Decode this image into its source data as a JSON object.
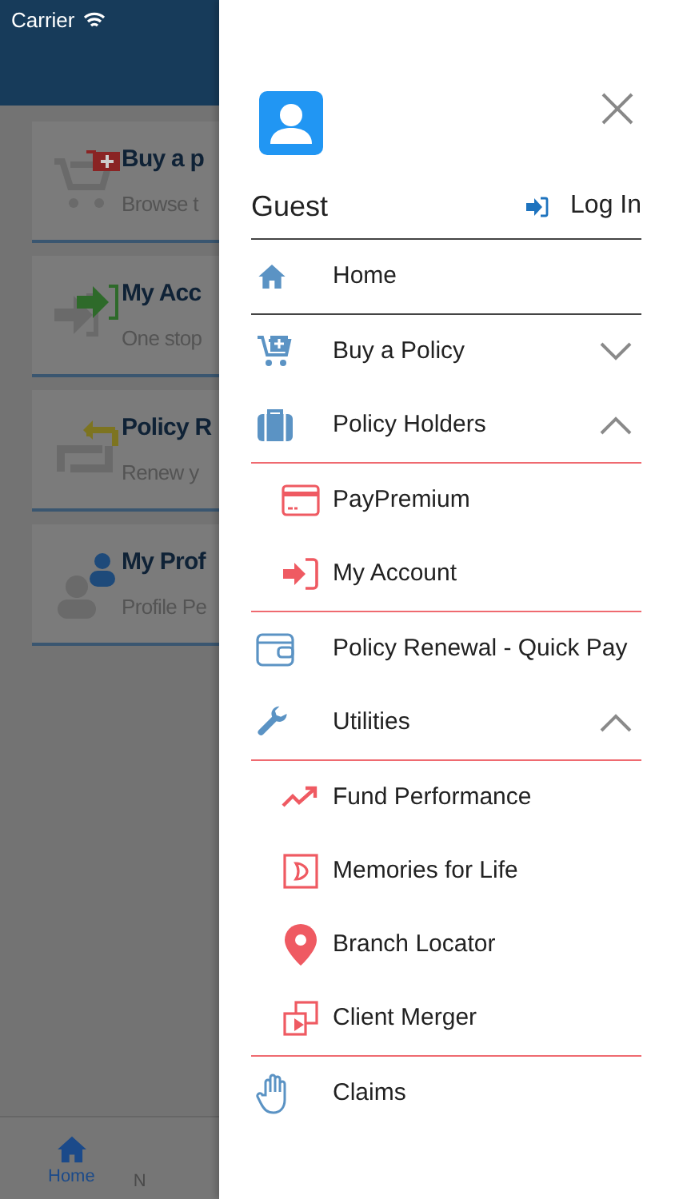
{
  "status_bar": {
    "carrier": "Carrier"
  },
  "cards": [
    {
      "title": "Buy a p",
      "subtitle": "Browse t"
    },
    {
      "title": "My Acc",
      "subtitle": "One stop"
    },
    {
      "title": "Policy R",
      "subtitle": "Renew y"
    },
    {
      "title": "My Prof",
      "subtitle": "Profile Pe"
    }
  ],
  "tab_bar": [
    {
      "label": "Home",
      "selected": true
    },
    {
      "label": "N",
      "selected": false
    }
  ],
  "drawer": {
    "user": "Guest",
    "login": "Log In",
    "menu": [
      {
        "kind": "link",
        "label": "Home"
      },
      {
        "kind": "group",
        "label": "Buy a Policy",
        "expanded": false
      },
      {
        "kind": "group",
        "label": "Policy Holders",
        "expanded": true,
        "children": [
          {
            "label": "PayPremium"
          },
          {
            "label": "My Account"
          }
        ]
      },
      {
        "kind": "link",
        "label": "Policy Renewal - Quick Pay"
      },
      {
        "kind": "group",
        "label": "Utilities",
        "expanded": true,
        "children": [
          {
            "label": "Fund Performance"
          },
          {
            "label": "Memories for Life"
          },
          {
            "label": "Branch Locator"
          },
          {
            "label": "Client Merger"
          }
        ]
      },
      {
        "kind": "link",
        "label": "Claims"
      }
    ]
  }
}
